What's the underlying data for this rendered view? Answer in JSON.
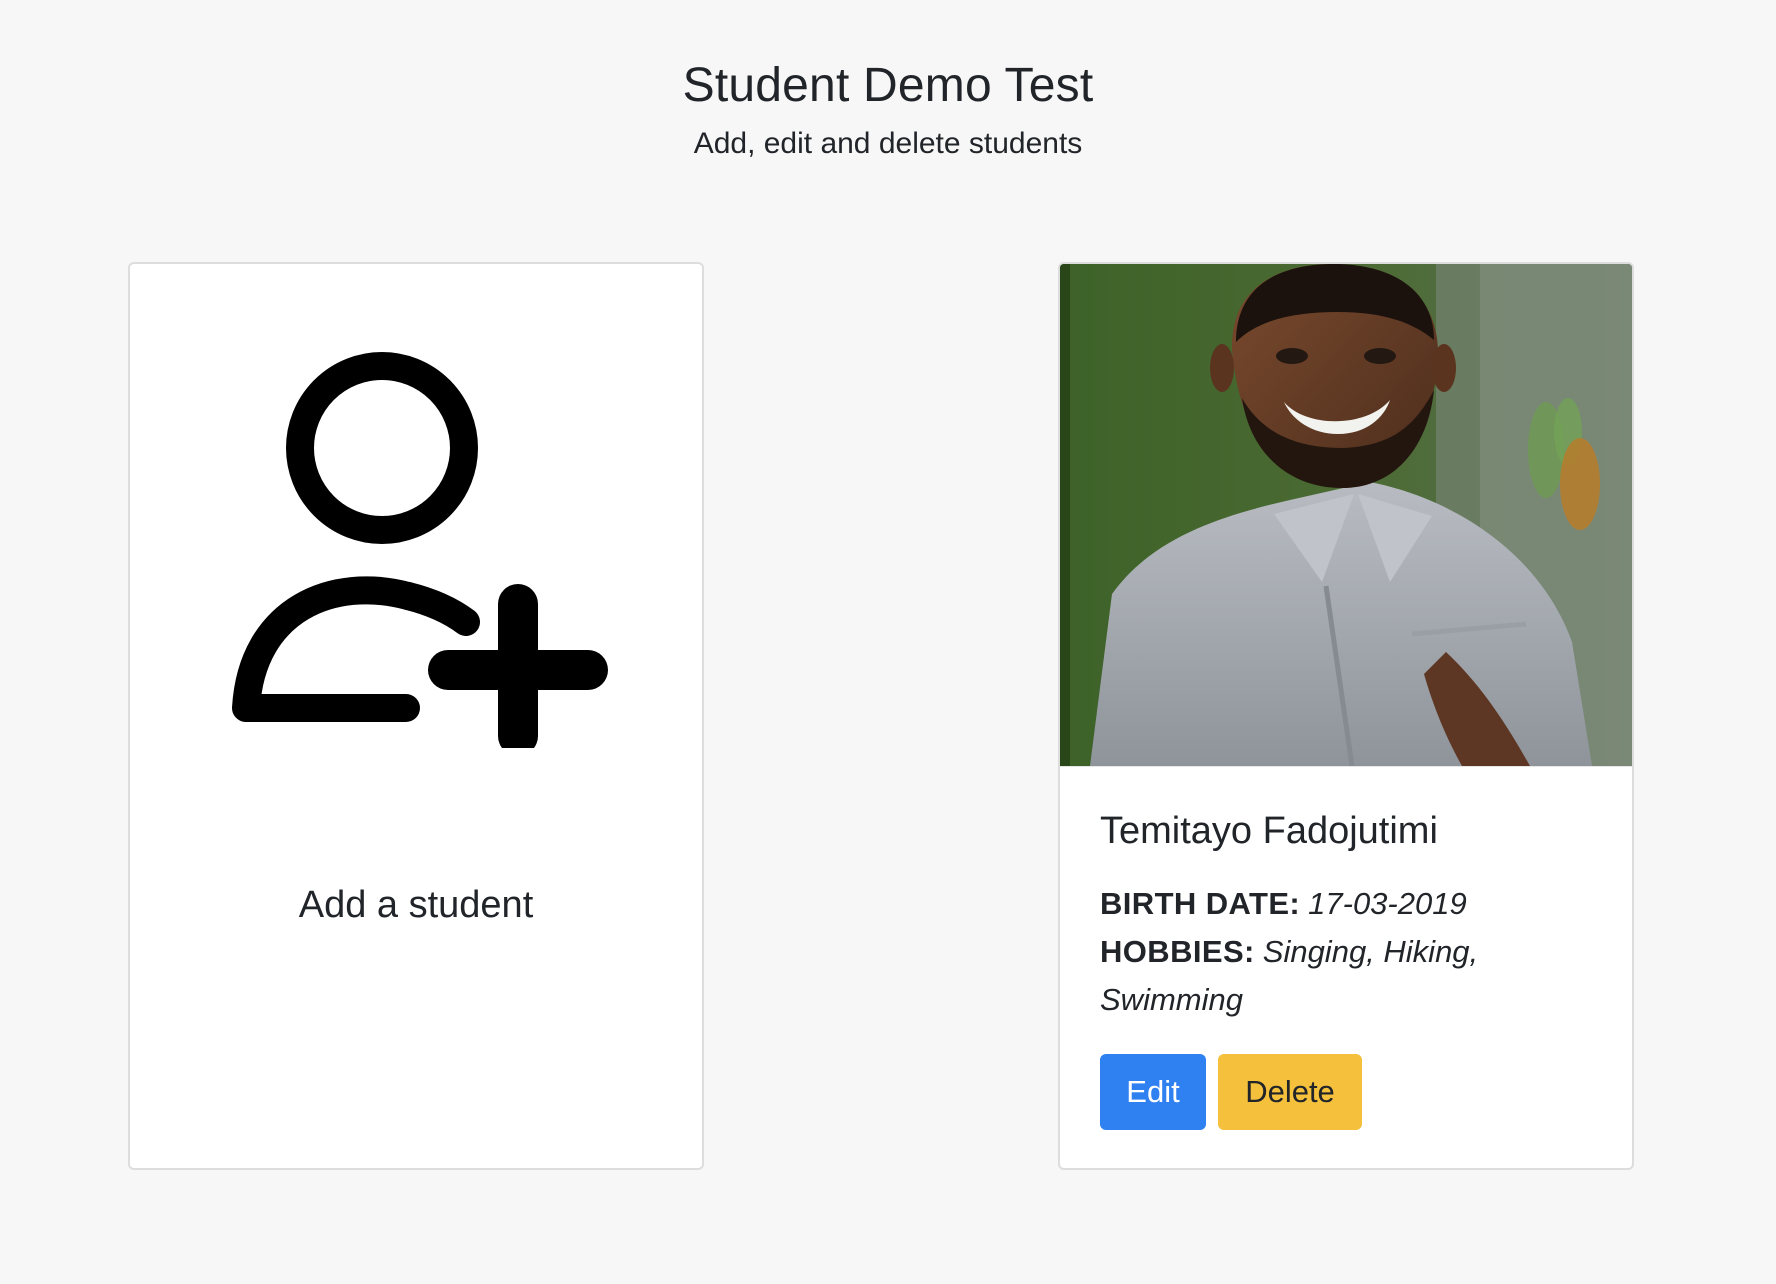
{
  "header": {
    "title": "Student Demo Test",
    "subtitle": "Add, edit and delete students"
  },
  "add_card": {
    "label": "Add a student",
    "icon": "add-user-icon"
  },
  "student_card": {
    "photo": "student-photo",
    "name": "Temitayo Fadojutimi",
    "birth_date_label": "BIRTH DATE:",
    "birth_date_value": "17-03-2019",
    "hobbies_label": "HOBBIES:",
    "hobbies_value": "Singing, Hiking, Swimming",
    "edit_label": "Edit",
    "delete_label": "Delete",
    "colors": {
      "edit": "#2f80f0",
      "delete": "#f5c13c"
    }
  }
}
